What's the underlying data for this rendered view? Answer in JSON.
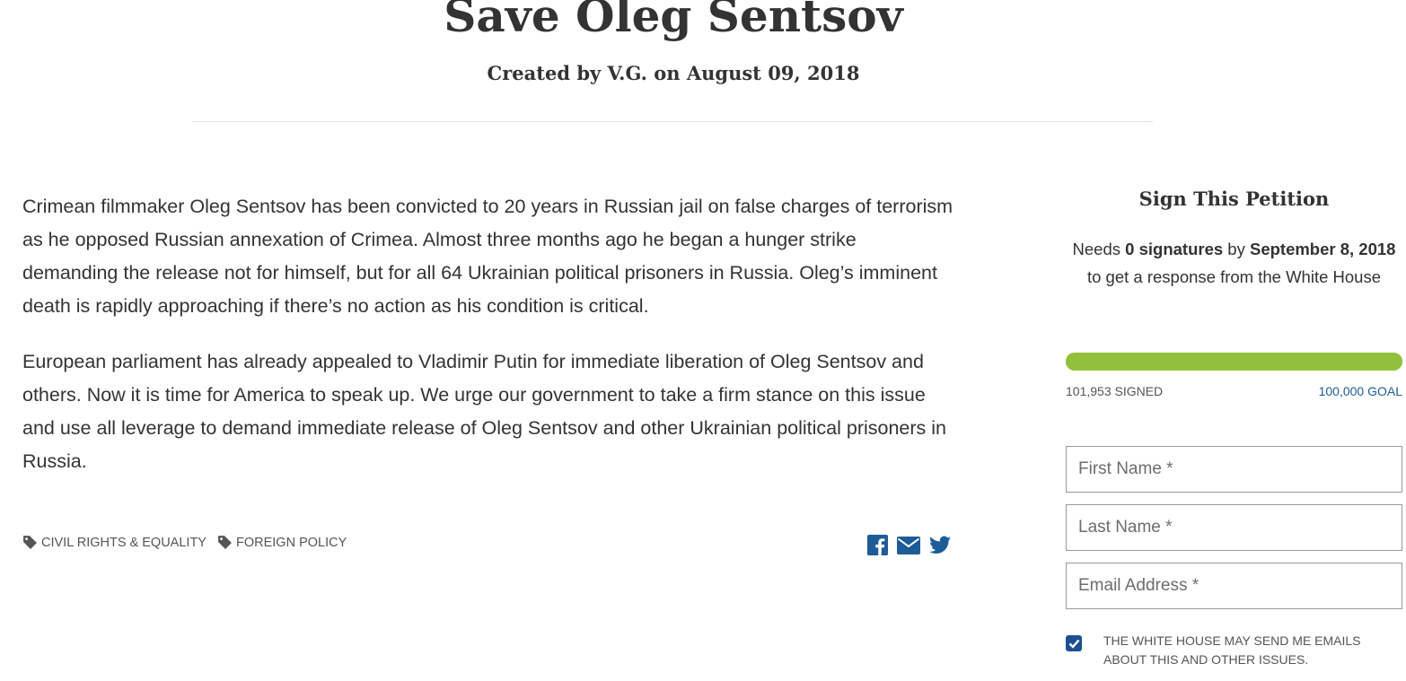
{
  "petition": {
    "title": "Save Oleg Sentsov",
    "byline": "Created by V.G. on August 09, 2018",
    "paragraphs": [
      "Crimean filmmaker Oleg Sentsov has been convicted to 20 years in Russian jail on false charges of terrorism as he opposed Russian annexation of Crimea. Almost three months ago he began a hunger strike demanding the release not for himself, but for all 64 Ukrainian political prisoners in Russia. Oleg’s imminent death is rapidly approaching if there’s no action as his condition is critical.",
      "European parliament has already appealed to Vladimir Putin for immediate liberation of Oleg Sentsov and others. Now it is time for America to speak up. We urge our government to take a firm stance on this issue and use all leverage to demand immediate release of Oleg Sentsov and other Ukrainian political prisoners in Russia."
    ],
    "tags": [
      "CIVIL RIGHTS & EQUALITY",
      "FOREIGN POLICY"
    ],
    "share_icons": [
      "facebook-icon",
      "email-icon",
      "twitter-icon"
    ]
  },
  "sidebar": {
    "heading": "Sign This Petition",
    "needs_prefix": "Needs ",
    "needs_count": "0 signatures",
    "needs_by": " by ",
    "needs_date": "September 8, 2018",
    "needs_suffix": " to get a response from the White House",
    "progress_fraction": 1.0,
    "signed_label": "101,953 SIGNED",
    "goal_label": "100,000 GOAL",
    "first_name_placeholder": "First Name *",
    "last_name_placeholder": "Last Name *",
    "email_placeholder": "Email Address *",
    "consent_label": "THE WHITE HOUSE MAY SEND ME EMAILS ABOUT THIS AND OTHER ISSUES.",
    "consent_checked": true
  },
  "colors": {
    "text": "#333333",
    "progress": "#93c03c",
    "accent_blue": "#1d5c96",
    "checkbox": "#1d4f91"
  }
}
